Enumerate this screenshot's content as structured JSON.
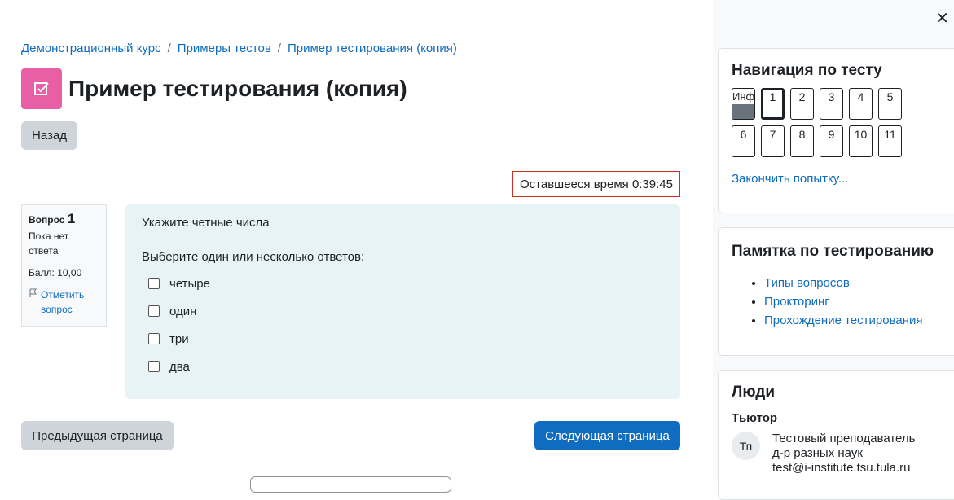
{
  "breadcrumb": [
    "Демонстрационный курс",
    "Примеры тестов",
    "Пример тестирования (копия)"
  ],
  "page_title": "Пример тестирования (копия)",
  "back_label": "Назад",
  "timer_text": "Оставшееся время 0:39:45",
  "question": {
    "label": "Вопрос",
    "number": "1",
    "state": "Пока нет ответа",
    "grade": "Балл: 10,00",
    "flag_label": "Отметить вопрос",
    "text": "Укажите четные числа",
    "prompt": "Выберите один или несколько ответов:",
    "options": [
      "четыре",
      "один",
      "три",
      "два"
    ]
  },
  "prev_label": "Предыдущая страница",
  "next_label": "Следующая страница",
  "nav_block": {
    "title": "Навигация по тесту",
    "buttons": [
      "Инф",
      "1",
      "2",
      "3",
      "4",
      "5",
      "6",
      "7",
      "8",
      "9",
      "10",
      "11"
    ],
    "finish_label": "Закончить попытку..."
  },
  "memo_block": {
    "title": "Памятка по тестированию",
    "links": [
      "Типы вопросов",
      "Прокторинг",
      "Прохождение тестирования"
    ]
  },
  "people_block": {
    "title": "Люди",
    "role": "Тьютор",
    "initials": "Тп",
    "name": "Тестовый преподаватель",
    "degree": "д-р разных наук",
    "email": "test@i-institute.tsu.tula.ru"
  },
  "colors": {
    "accent": "#0f6cbf",
    "quiz_icon": "#e95fa6",
    "timer_border": "#ca3120",
    "question_bg": "#e7f3f5"
  }
}
